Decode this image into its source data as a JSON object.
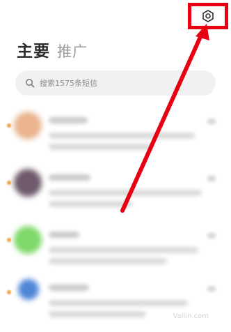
{
  "header": {
    "tab_main": "主要",
    "tab_promotions": "推广",
    "settings_icon": "gear-icon"
  },
  "search": {
    "placeholder": "搜索1575条短信",
    "icon": "search-icon"
  },
  "conversations": [
    {
      "avatar_color": "#e9b48e",
      "blurred": true
    },
    {
      "avatar_color": "#6e5a6b",
      "blurred": true
    },
    {
      "avatar_color": "#7fd96a",
      "blurred": true
    },
    {
      "avatar_color": "#4e86d6",
      "blurred": true
    }
  ],
  "watermark": "Vallin.com",
  "colors": {
    "highlight": "#e60012",
    "unread_dot": "#f0a040",
    "search_bg": "#f1f1f1"
  }
}
